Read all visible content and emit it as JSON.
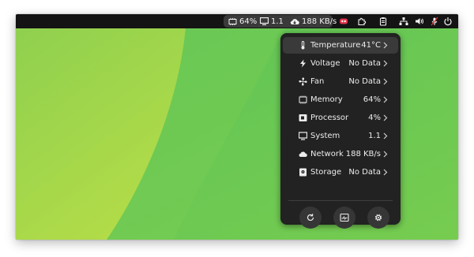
{
  "topbar": {
    "indicators": [
      {
        "icon": "memory-chip-icon",
        "value": "64%"
      },
      {
        "icon": "monitor-icon",
        "value": "1.1"
      },
      {
        "icon": "cloud-download-icon",
        "value": "188 KB/s"
      }
    ],
    "tray_icons": [
      "app-indicator-icon",
      "extension-puzzle-icon",
      "clipboard-icon",
      "network-wired-icon",
      "volume-icon",
      "microphone-muted-icon",
      "power-icon"
    ]
  },
  "menu": {
    "items": [
      {
        "icon": "thermometer-icon",
        "label": "Temperature",
        "value": "41°C"
      },
      {
        "icon": "voltage-bolt-icon",
        "label": "Voltage",
        "value": "No Data"
      },
      {
        "icon": "fan-icon",
        "label": "Fan",
        "value": "No Data"
      },
      {
        "icon": "memory-chip-icon",
        "label": "Memory",
        "value": "64%"
      },
      {
        "icon": "processor-icon",
        "label": "Processor",
        "value": "4%"
      },
      {
        "icon": "monitor-icon",
        "label": "System",
        "value": "1.1"
      },
      {
        "icon": "cloud-icon",
        "label": "Network",
        "value": "188 KB/s"
      },
      {
        "icon": "storage-drive-icon",
        "label": "Storage",
        "value": "No Data"
      }
    ],
    "actions": [
      {
        "icon": "refresh-icon"
      },
      {
        "icon": "system-monitor-icon"
      },
      {
        "icon": "settings-gear-icon"
      }
    ]
  },
  "colors": {
    "wallpaper_green": "#6fcb51",
    "wallpaper_lime": "#a5d84a",
    "topbar": "#141414",
    "menu_bg": "#222222",
    "menu_active_row": "#3a3a3a"
  }
}
